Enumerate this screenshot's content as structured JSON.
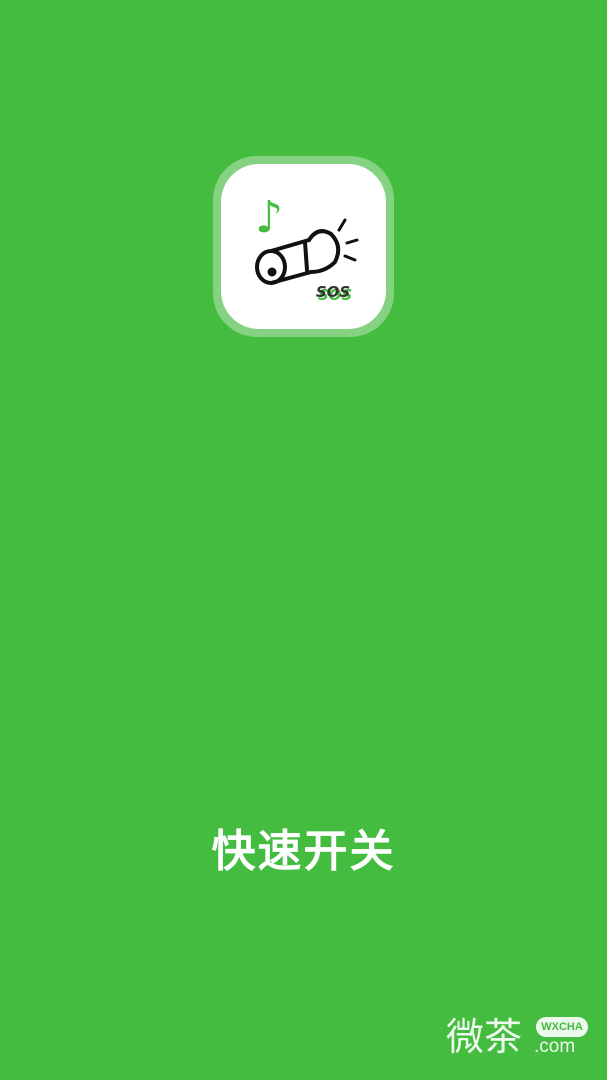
{
  "splash": {
    "slogan": "快速开关",
    "icon": {
      "name": "flashlight-sos-icon",
      "sos_label": "SOS",
      "note_glyph": "♪"
    }
  },
  "watermark": {
    "cn": "微茶",
    "badge": "WXCHA",
    "domain": ".com"
  },
  "colors": {
    "background": "#44bc3f",
    "icon_bg": "#ffffff",
    "accent_green": "#44bc3f",
    "ink": "#111111",
    "text": "#ffffff"
  }
}
